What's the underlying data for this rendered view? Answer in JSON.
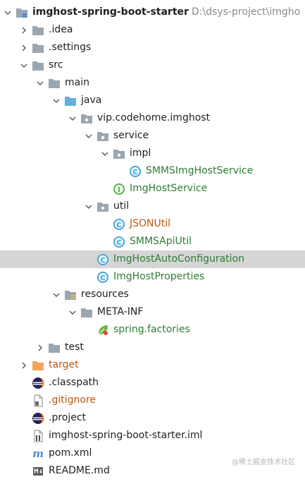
{
  "project": {
    "name": "imghost-spring-boot-starter",
    "path": "D:\\dsys-project\\imgho"
  },
  "tree": [
    {
      "label": "imghost-spring-boot-starter",
      "depth": 0,
      "arrow": "down",
      "icon": "module-folder-icon",
      "name": "tree-item-project-root",
      "style": "bold"
    },
    {
      "label": ".idea",
      "depth": 1,
      "arrow": "right",
      "icon": "folder-icon",
      "name": "tree-item-idea"
    },
    {
      "label": ".settings",
      "depth": 1,
      "arrow": "right",
      "icon": "folder-icon",
      "name": "tree-item-settings"
    },
    {
      "label": "src",
      "depth": 1,
      "arrow": "down",
      "icon": "folder-icon",
      "name": "tree-item-src"
    },
    {
      "label": "main",
      "depth": 2,
      "arrow": "down",
      "icon": "folder-icon",
      "name": "tree-item-main"
    },
    {
      "label": "java",
      "depth": 3,
      "arrow": "down",
      "icon": "source-folder-icon",
      "name": "tree-item-java"
    },
    {
      "label": "vip.codehome.imghost",
      "depth": 4,
      "arrow": "down",
      "icon": "package-icon",
      "name": "tree-item-package-imghost"
    },
    {
      "label": "service",
      "depth": 5,
      "arrow": "down",
      "icon": "package-icon",
      "name": "tree-item-service"
    },
    {
      "label": "impl",
      "depth": 6,
      "arrow": "down",
      "icon": "package-icon",
      "name": "tree-item-impl"
    },
    {
      "label": "SMMSImgHostService",
      "depth": 7,
      "arrow": "none",
      "icon": "class-icon",
      "name": "tree-item-smms-img-host-service",
      "style": "green"
    },
    {
      "label": "ImgHostService",
      "depth": 6,
      "arrow": "none",
      "icon": "interface-icon",
      "name": "tree-item-img-host-service",
      "style": "green"
    },
    {
      "label": "util",
      "depth": 5,
      "arrow": "down",
      "icon": "package-icon",
      "name": "tree-item-util"
    },
    {
      "label": "JSONUtil",
      "depth": 6,
      "arrow": "none",
      "icon": "class-icon",
      "name": "tree-item-json-util",
      "style": "orange"
    },
    {
      "label": "SMMSApiUtil",
      "depth": 6,
      "arrow": "none",
      "icon": "class-icon",
      "name": "tree-item-smms-api-util",
      "style": "green"
    },
    {
      "label": "ImgHostAutoConfiguration",
      "depth": 5,
      "arrow": "none",
      "icon": "class-icon",
      "name": "tree-item-img-host-auto-configuration",
      "style": "green",
      "selected": true
    },
    {
      "label": "ImgHostProperties",
      "depth": 5,
      "arrow": "none",
      "icon": "class-icon",
      "name": "tree-item-img-host-properties",
      "style": "green"
    },
    {
      "label": "resources",
      "depth": 3,
      "arrow": "down",
      "icon": "resources-folder-icon",
      "name": "tree-item-resources"
    },
    {
      "label": "META-INF",
      "depth": 4,
      "arrow": "down",
      "icon": "folder-icon",
      "name": "tree-item-meta-inf"
    },
    {
      "label": "spring.factories",
      "depth": 5,
      "arrow": "none",
      "icon": "spring-leaf-icon",
      "name": "tree-item-spring-factories",
      "style": "green"
    },
    {
      "label": "test",
      "depth": 2,
      "arrow": "right",
      "icon": "folder-icon",
      "name": "tree-item-test"
    },
    {
      "label": "target",
      "depth": 1,
      "arrow": "right",
      "icon": "excluded-folder-icon",
      "name": "tree-item-target",
      "style": "orange"
    },
    {
      "label": ".classpath",
      "depth": 1,
      "arrow": "none",
      "icon": "eclipse-icon",
      "name": "tree-item-classpath"
    },
    {
      "label": ".gitignore",
      "depth": 1,
      "arrow": "none",
      "icon": "file-icon",
      "name": "tree-item-gitignore",
      "style": "orange"
    },
    {
      "label": ".project",
      "depth": 1,
      "arrow": "none",
      "icon": "eclipse-icon",
      "name": "tree-item-project-file"
    },
    {
      "label": "imghost-spring-boot-starter.iml",
      "depth": 1,
      "arrow": "none",
      "icon": "iml-file-icon",
      "name": "tree-item-iml"
    },
    {
      "label": "pom.xml",
      "depth": 1,
      "arrow": "none",
      "icon": "maven-icon",
      "name": "tree-item-pom"
    },
    {
      "label": "README.md",
      "depth": 1,
      "arrow": "none",
      "icon": "markdown-icon",
      "name": "tree-item-readme"
    }
  ],
  "watermark": "@稀土掘金技术社区",
  "colors": {
    "folder": "#9aa7b0",
    "source_folder": "#62b0de",
    "excluded_folder": "#f3a45c",
    "class_icon": "#3aa3d8",
    "interface_icon": "#57a848",
    "selected_row": "#d5d5d5",
    "green_text": "#2e7d32",
    "orange_text": "#b8570f"
  }
}
